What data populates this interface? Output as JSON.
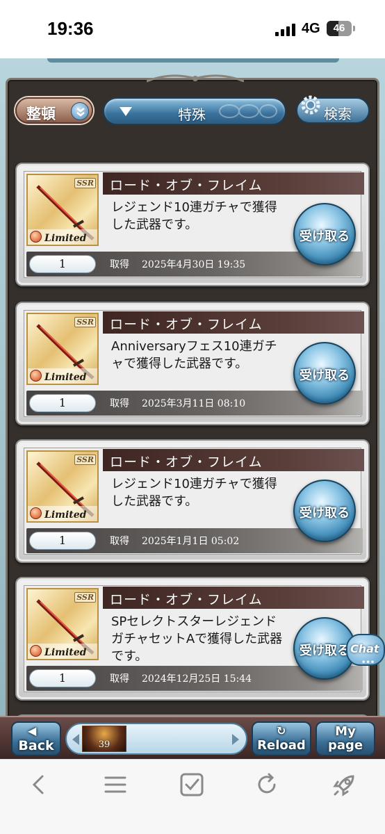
{
  "status_bar": {
    "time": "19:36",
    "network": "4G",
    "battery": "46"
  },
  "filter": {
    "sort_label": "整頓",
    "category_value": "特殊",
    "search_label": "検索"
  },
  "cards": [
    {
      "rarity": "SSR",
      "limited": "Limited",
      "name": "ロード・オブ・フレイム",
      "description": "レジェンド10連ガチャで獲得した武器です。",
      "count": "1",
      "acquired_label": "取得",
      "date": "2025年4月30日 19:35",
      "receive_label": "受け取る"
    },
    {
      "rarity": "SSR",
      "limited": "Limited",
      "name": "ロード・オブ・フレイム",
      "description": "Anniversaryフェス10連ガチャで獲得した武器です。",
      "count": "1",
      "acquired_label": "取得",
      "date": "2025年3月11日 08:10",
      "receive_label": "受け取る"
    },
    {
      "rarity": "SSR",
      "limited": "Limited",
      "name": "ロード・オブ・フレイム",
      "description": "レジェンド10連ガチャで獲得した武器です。",
      "count": "1",
      "acquired_label": "取得",
      "date": "2025年1月1日 05:02",
      "receive_label": "受け取る"
    },
    {
      "rarity": "SSR",
      "limited": "Limited",
      "name": "ロード・オブ・フレイム",
      "description": "SPセレクトスターレジェンドガチャセットAで獲得した武器です。",
      "count": "1",
      "acquired_label": "取得",
      "date": "2024年12月25日 15:44",
      "receive_label": "受け取る"
    }
  ],
  "chat": {
    "label": "Chat",
    "dots": "•••"
  },
  "game_nav": {
    "back_label": "Back",
    "item_count": "39",
    "reload_label": "Reload",
    "mypage_line1": "My",
    "mypage_line2": "page"
  },
  "colors": {
    "accent_blue": "#3c88b5",
    "name_bar": "#3e2622",
    "frame": "#35302c"
  },
  "icons": {
    "sort": "chevron-down-double-icon",
    "dropdown": "triangle-down-icon",
    "search": "gear-icon",
    "item": "sword-icon",
    "element": "fire-element-icon",
    "safari": [
      "back-icon",
      "menu-icon",
      "checkbox-icon",
      "refresh-icon",
      "rocket-icon"
    ]
  }
}
